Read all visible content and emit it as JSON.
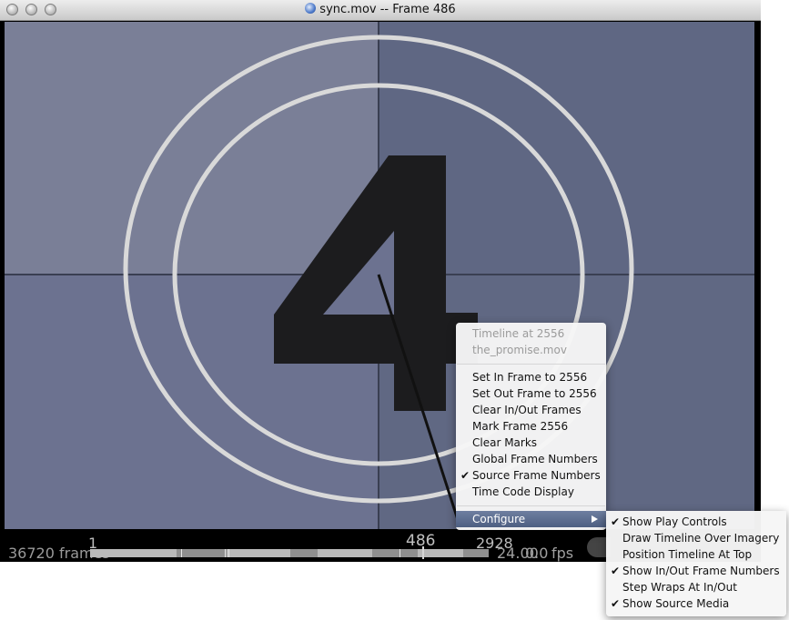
{
  "window": {
    "title": "sync.mov -- Frame 486"
  },
  "transport": {
    "frame_count": "36720 frames",
    "range_start": "1",
    "range_end": "2928",
    "current_frame": "486",
    "fps_value": "24.00",
    "speed_value": "0.0",
    "fps_unit": "fps"
  },
  "video": {
    "countdown_digit": "4"
  },
  "context_menu": {
    "header_timeline": "Timeline at 2556",
    "header_source": "the_promise.mov",
    "items": [
      {
        "label": "Set In Frame to 2556",
        "checked": false
      },
      {
        "label": "Set Out Frame to 2556",
        "checked": false
      },
      {
        "label": "Clear In/Out Frames",
        "checked": false
      },
      {
        "label": "Mark Frame 2556",
        "checked": false
      },
      {
        "label": "Clear Marks",
        "checked": false
      },
      {
        "label": "Global Frame Numbers",
        "checked": false
      },
      {
        "label": "Source Frame Numbers",
        "checked": true
      },
      {
        "label": "Time Code Display",
        "checked": false
      }
    ],
    "configure_label": "Configure",
    "checkmark": "✔"
  },
  "configure_submenu": {
    "items": [
      {
        "label": "Show Play Controls",
        "checked": true
      },
      {
        "label": "Draw Timeline Over Imagery",
        "checked": false
      },
      {
        "label": "Position Timeline At Top",
        "checked": false
      },
      {
        "label": "Show In/Out Frame Numbers",
        "checked": true
      },
      {
        "label": "Step Wraps At In/Out",
        "checked": false
      },
      {
        "label": "Show Source Media",
        "checked": true
      }
    ]
  },
  "colors": {
    "menu_highlight": "#5a6a8c",
    "video_background": "#69708c",
    "digit_color": "#1c1c1e"
  }
}
